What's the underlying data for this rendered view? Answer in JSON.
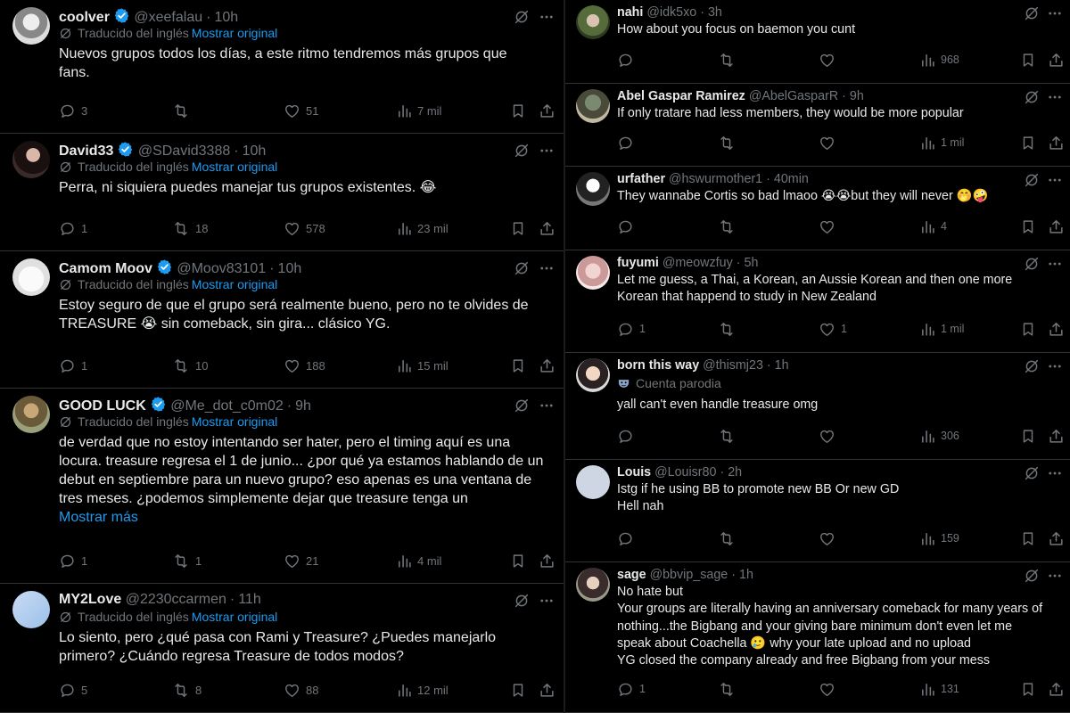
{
  "left": {
    "tweets": [
      {
        "name": "coolver",
        "handle": "@xeefalau",
        "time": "10h",
        "verified": true,
        "translated": true,
        "text": "Nuevos grupos todos los días, a este ritmo tendremos más grupos que\nfans.",
        "replies": "3",
        "reposts": "",
        "likes": "51",
        "views": "7 mil"
      },
      {
        "name": "David33",
        "handle": "@SDavid3388",
        "time": "10h",
        "verified": true,
        "translated": true,
        "text": "Perra, ni siquiera puedes manejar tus grupos existentes. 😂",
        "replies": "1",
        "reposts": "18",
        "likes": "578",
        "views": "23 mil"
      },
      {
        "name": "Camom Moov",
        "handle": "@Moov83101",
        "time": "10h",
        "verified": true,
        "translated": true,
        "text": "Estoy seguro de que el grupo será realmente bueno, pero no te olvides de\nTREASURE 😭 sin comeback, sin gira... clásico YG.",
        "replies": "1",
        "reposts": "10",
        "likes": "188",
        "views": "15 mil"
      },
      {
        "name": "GOOD LUCK",
        "handle": "@Me_dot_c0m02",
        "time": "9h",
        "verified": true,
        "translated": true,
        "text": "de verdad que no estoy intentando ser hater, pero el timing aquí es una\nlocura. treasure regresa el 1 de junio... ¿por qué ya estamos hablando de un\ndebut en septiembre para un nuevo grupo? eso apenas es una ventana de\ntres meses. ¿podemos simplemente dejar que treasure tenga un",
        "show_more": "Mostrar más",
        "replies": "1",
        "reposts": "1",
        "likes": "21",
        "views": "4 mil"
      },
      {
        "name": "MY2Love",
        "handle": "@2230ccarmen",
        "time": "11h",
        "verified": false,
        "translated": true,
        "text": "Lo siento, pero ¿qué pasa con Rami y Treasure? ¿Puedes manejarlo\nprimero? ¿Cuándo regresa Treasure de todos modos?",
        "replies": "5",
        "reposts": "8",
        "likes": "88",
        "views": "12 mil"
      }
    ]
  },
  "right": {
    "tweets": [
      {
        "name": "nahi",
        "handle": "@idk5xo",
        "time": "3h",
        "text": "How about you focus on baemon you cunt",
        "replies": "",
        "reposts": "",
        "likes": "",
        "views": "968"
      },
      {
        "name": "Abel Gaspar Ramirez",
        "handle": "@AbelGasparR",
        "time": "9h",
        "text": "If only tratare had less members, they would be more popular",
        "replies": "",
        "reposts": "",
        "likes": "",
        "views": "1 mil"
      },
      {
        "name": "urfather",
        "handle": "@hswurmother1",
        "time": "40min",
        "text": "They wannabe Cortis so bad lmaoo 😭😭but they will never 🤭🤪",
        "replies": "",
        "reposts": "",
        "likes": "",
        "views": "4"
      },
      {
        "name": "fuyumi",
        "handle": "@meowzfuy",
        "time": "5h",
        "text": "Let me guess, a Thai, a Korean, an Aussie Korean and then one more\nKorean that happend to study in New Zealand",
        "replies": "1",
        "reposts": "",
        "likes": "1",
        "views": "1 mil"
      },
      {
        "name": "born this way",
        "handle": "@thismj23",
        "time": "1h",
        "parody": "Cuenta parodia",
        "text": "yall can't even handle treasure omg",
        "replies": "",
        "reposts": "",
        "likes": "",
        "views": "306"
      },
      {
        "name": "Louis",
        "handle": "@Louisr80",
        "time": "2h",
        "text": "Istg if he using BB to promote new BB Or new GD\nHell nah",
        "replies": "",
        "reposts": "",
        "likes": "",
        "views": "159"
      },
      {
        "name": "sage",
        "handle": "@bbvip_sage",
        "time": "1h",
        "text": "No hate but\nYour groups are literally having an anniversary comeback for many years of\nnothing...the Bigbang  and your giving bare minimum don't even let me\nspeak about Coachella 🥲 why your late upload and no upload\nYG closed the company already and free Bigbang from your mess",
        "replies": "1",
        "reposts": "",
        "likes": "",
        "views": "131"
      }
    ]
  },
  "labels": {
    "translated_from": "Traducido del inglés",
    "show_original": "Mostrar original",
    "separator": "·"
  },
  "colors": {
    "background": "#000000",
    "text": "#e7e9ea",
    "secondary": "#71767b",
    "link": "#1d9bf0",
    "verified": "#1d9bf0",
    "divider": "#2f3336"
  }
}
